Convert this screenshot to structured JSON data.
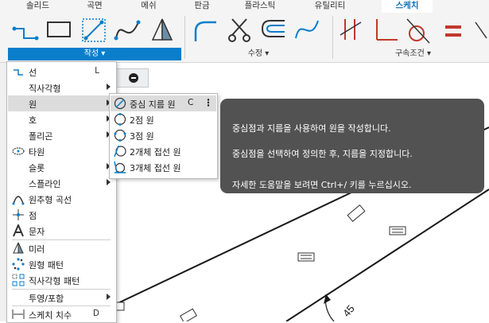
{
  "ribbon": {
    "tabs": [
      {
        "label": "솔리드",
        "active": false
      },
      {
        "label": "곡면",
        "active": false
      },
      {
        "label": "메쉬",
        "active": false
      },
      {
        "label": "판금",
        "active": false
      },
      {
        "label": "플라스틱",
        "active": false
      },
      {
        "label": "유틸리티",
        "active": false
      },
      {
        "label": "스케치",
        "active": true
      }
    ],
    "groups": {
      "create": "작성",
      "modify": "수정",
      "constraints": "구속조건"
    }
  },
  "menu": {
    "items": [
      {
        "label": "선",
        "shortcut": "L",
        "icon": "line-icon"
      },
      {
        "label": "직사각형",
        "icon": "",
        "submenu": true
      },
      {
        "label": "원",
        "icon": "",
        "submenu": true
      },
      {
        "label": "호",
        "icon": "",
        "submenu": true
      },
      {
        "label": "폴리곤",
        "icon": "",
        "submenu": true
      },
      {
        "label": "타원",
        "icon": "ellipse-icon"
      },
      {
        "label": "슬롯",
        "icon": "",
        "submenu": true
      },
      {
        "label": "스플라인",
        "icon": "",
        "submenu": true
      },
      {
        "label": "원추형 곡선",
        "icon": "conic-curve-icon"
      },
      {
        "label": "점",
        "icon": "point-icon"
      },
      {
        "label": "문자",
        "icon": "text-icon"
      },
      {
        "label": "미러",
        "icon": "mirror-icon"
      },
      {
        "label": "원형 패턴",
        "icon": "circular-pattern-icon"
      },
      {
        "label": "직사각형 패턴",
        "icon": "rectangular-pattern-icon"
      },
      {
        "label": "투영/포함",
        "icon": "",
        "submenu": true
      },
      {
        "label": "스케치 치수",
        "shortcut": "D",
        "icon": "sketch-dimension-icon"
      }
    ]
  },
  "submenu": {
    "items": [
      {
        "label": "중심 지름 원",
        "shortcut": "C",
        "icon": "center-diameter-circle-icon"
      },
      {
        "label": "2점 원",
        "icon": "two-point-circle-icon"
      },
      {
        "label": "3점 원",
        "icon": "three-point-circle-icon"
      },
      {
        "label": "2개체 접선 원",
        "icon": "two-tangent-circle-icon"
      },
      {
        "label": "3개체 접선 원",
        "icon": "three-tangent-circle-icon"
      }
    ]
  },
  "tooltip": {
    "line1": "중심점과 지름을 사용하여 원을 작성합니다.",
    "line2": "중심점을 선택하여 정의한 후, 지름을 지정합니다.",
    "line3": "자세한 도움말을 보려면 Ctrl+/ 키를 누르십시오."
  },
  "canvas": {
    "dimension_text": "45"
  },
  "colors": {
    "accent": "#0a7ecb",
    "tooltip_bg": "#525252",
    "constraint_red": "#c0392b"
  }
}
